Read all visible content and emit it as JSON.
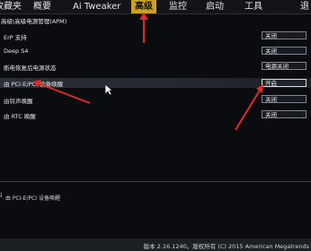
{
  "tabs": [
    {
      "label": "收藏夹"
    },
    {
      "label": "概要"
    },
    {
      "label": "Ai Tweaker"
    },
    {
      "label": "高级"
    },
    {
      "label": "监控"
    },
    {
      "label": "启动"
    },
    {
      "label": "工具"
    },
    {
      "label": "退"
    }
  ],
  "breadcrumb": "高级\\高级电源管理(APM)",
  "settings": [
    {
      "label": "ErP 支持",
      "value": "关闭"
    },
    {
      "label": "Deep S4",
      "value": "关闭"
    },
    {
      "label": "断电恢复后电源状态",
      "value": "电源关闭"
    },
    {
      "label": "由 PCI-E/PCI 设备唤醒",
      "value": "开启"
    },
    {
      "label": "由铃声唤醒",
      "value": "关闭"
    },
    {
      "label": "由 RTC 唤醒",
      "value": "关闭"
    }
  ],
  "help": "由 PCI-E/PCI 设备唤醒",
  "footer": {
    "version": "版本 2.16.1240。版权所有 (C) 2015 American Megatrends"
  },
  "colors": {
    "accent": "#c9a227",
    "arrow": "#e02a2a"
  }
}
